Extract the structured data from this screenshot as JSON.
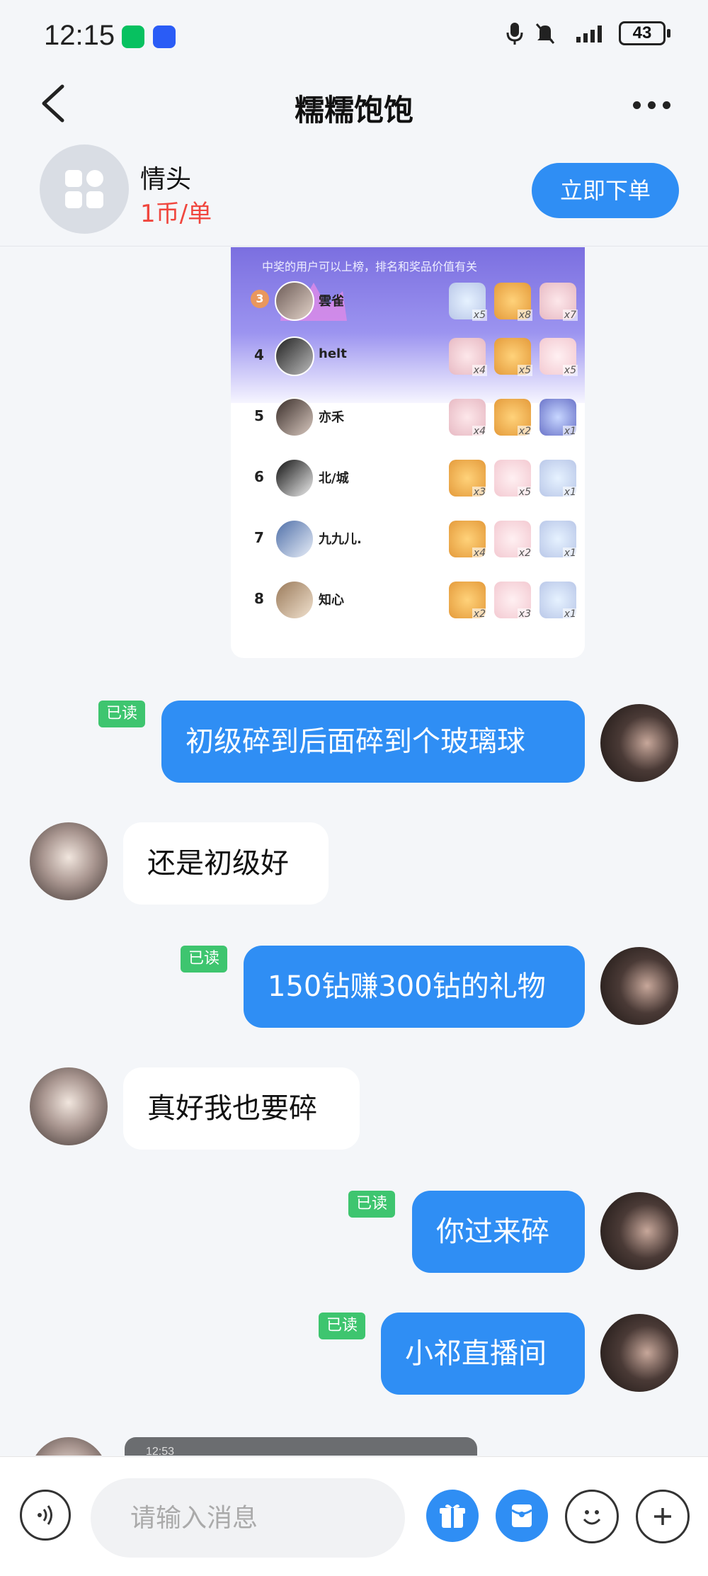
{
  "status_bar": {
    "time": "12:15",
    "battery": "43"
  },
  "header": {
    "title": "糯糯饱饱"
  },
  "service": {
    "name": "情头",
    "price": "1币/单",
    "order_button": "立即下单"
  },
  "leaderboard": {
    "note": "中奖的用户可以上榜，排名和奖品价值有关",
    "rows": [
      {
        "rank": "3",
        "name": "雲雀",
        "prizes": [
          "x5",
          "x8",
          "x7"
        ]
      },
      {
        "rank": "4",
        "name": "helt",
        "prizes": [
          "x4",
          "x5",
          "x5"
        ]
      },
      {
        "rank": "5",
        "name": "亦禾",
        "prizes": [
          "x4",
          "x2",
          "x1"
        ]
      },
      {
        "rank": "6",
        "name": "北/城",
        "prizes": [
          "x3",
          "x5",
          "x1"
        ]
      },
      {
        "rank": "7",
        "name": "九九儿.",
        "prizes": [
          "x4",
          "x2",
          "x1"
        ]
      },
      {
        "rank": "8",
        "name": "知心",
        "prizes": [
          "x2",
          "x3",
          "x1"
        ]
      }
    ]
  },
  "messages": [
    {
      "from": "me",
      "text": "初级碎到后面碎到个玻璃球",
      "read": "已读"
    },
    {
      "from": "other",
      "text": "还是初级好"
    },
    {
      "from": "me",
      "text": "150钻赚300钻的礼物",
      "read": "已读"
    },
    {
      "from": "other",
      "text": "真好我也要碎"
    },
    {
      "from": "me",
      "text": "你过来碎",
      "read": "已读"
    },
    {
      "from": "me",
      "text": "小祁直播间",
      "read": "已读"
    }
  ],
  "screenshot_preview": {
    "time": "12:53"
  },
  "input": {
    "placeholder": "请输入消息"
  },
  "colors": {
    "accent": "#2f8ef4",
    "read_badge": "#3ec56f",
    "price": "#f0463e"
  }
}
